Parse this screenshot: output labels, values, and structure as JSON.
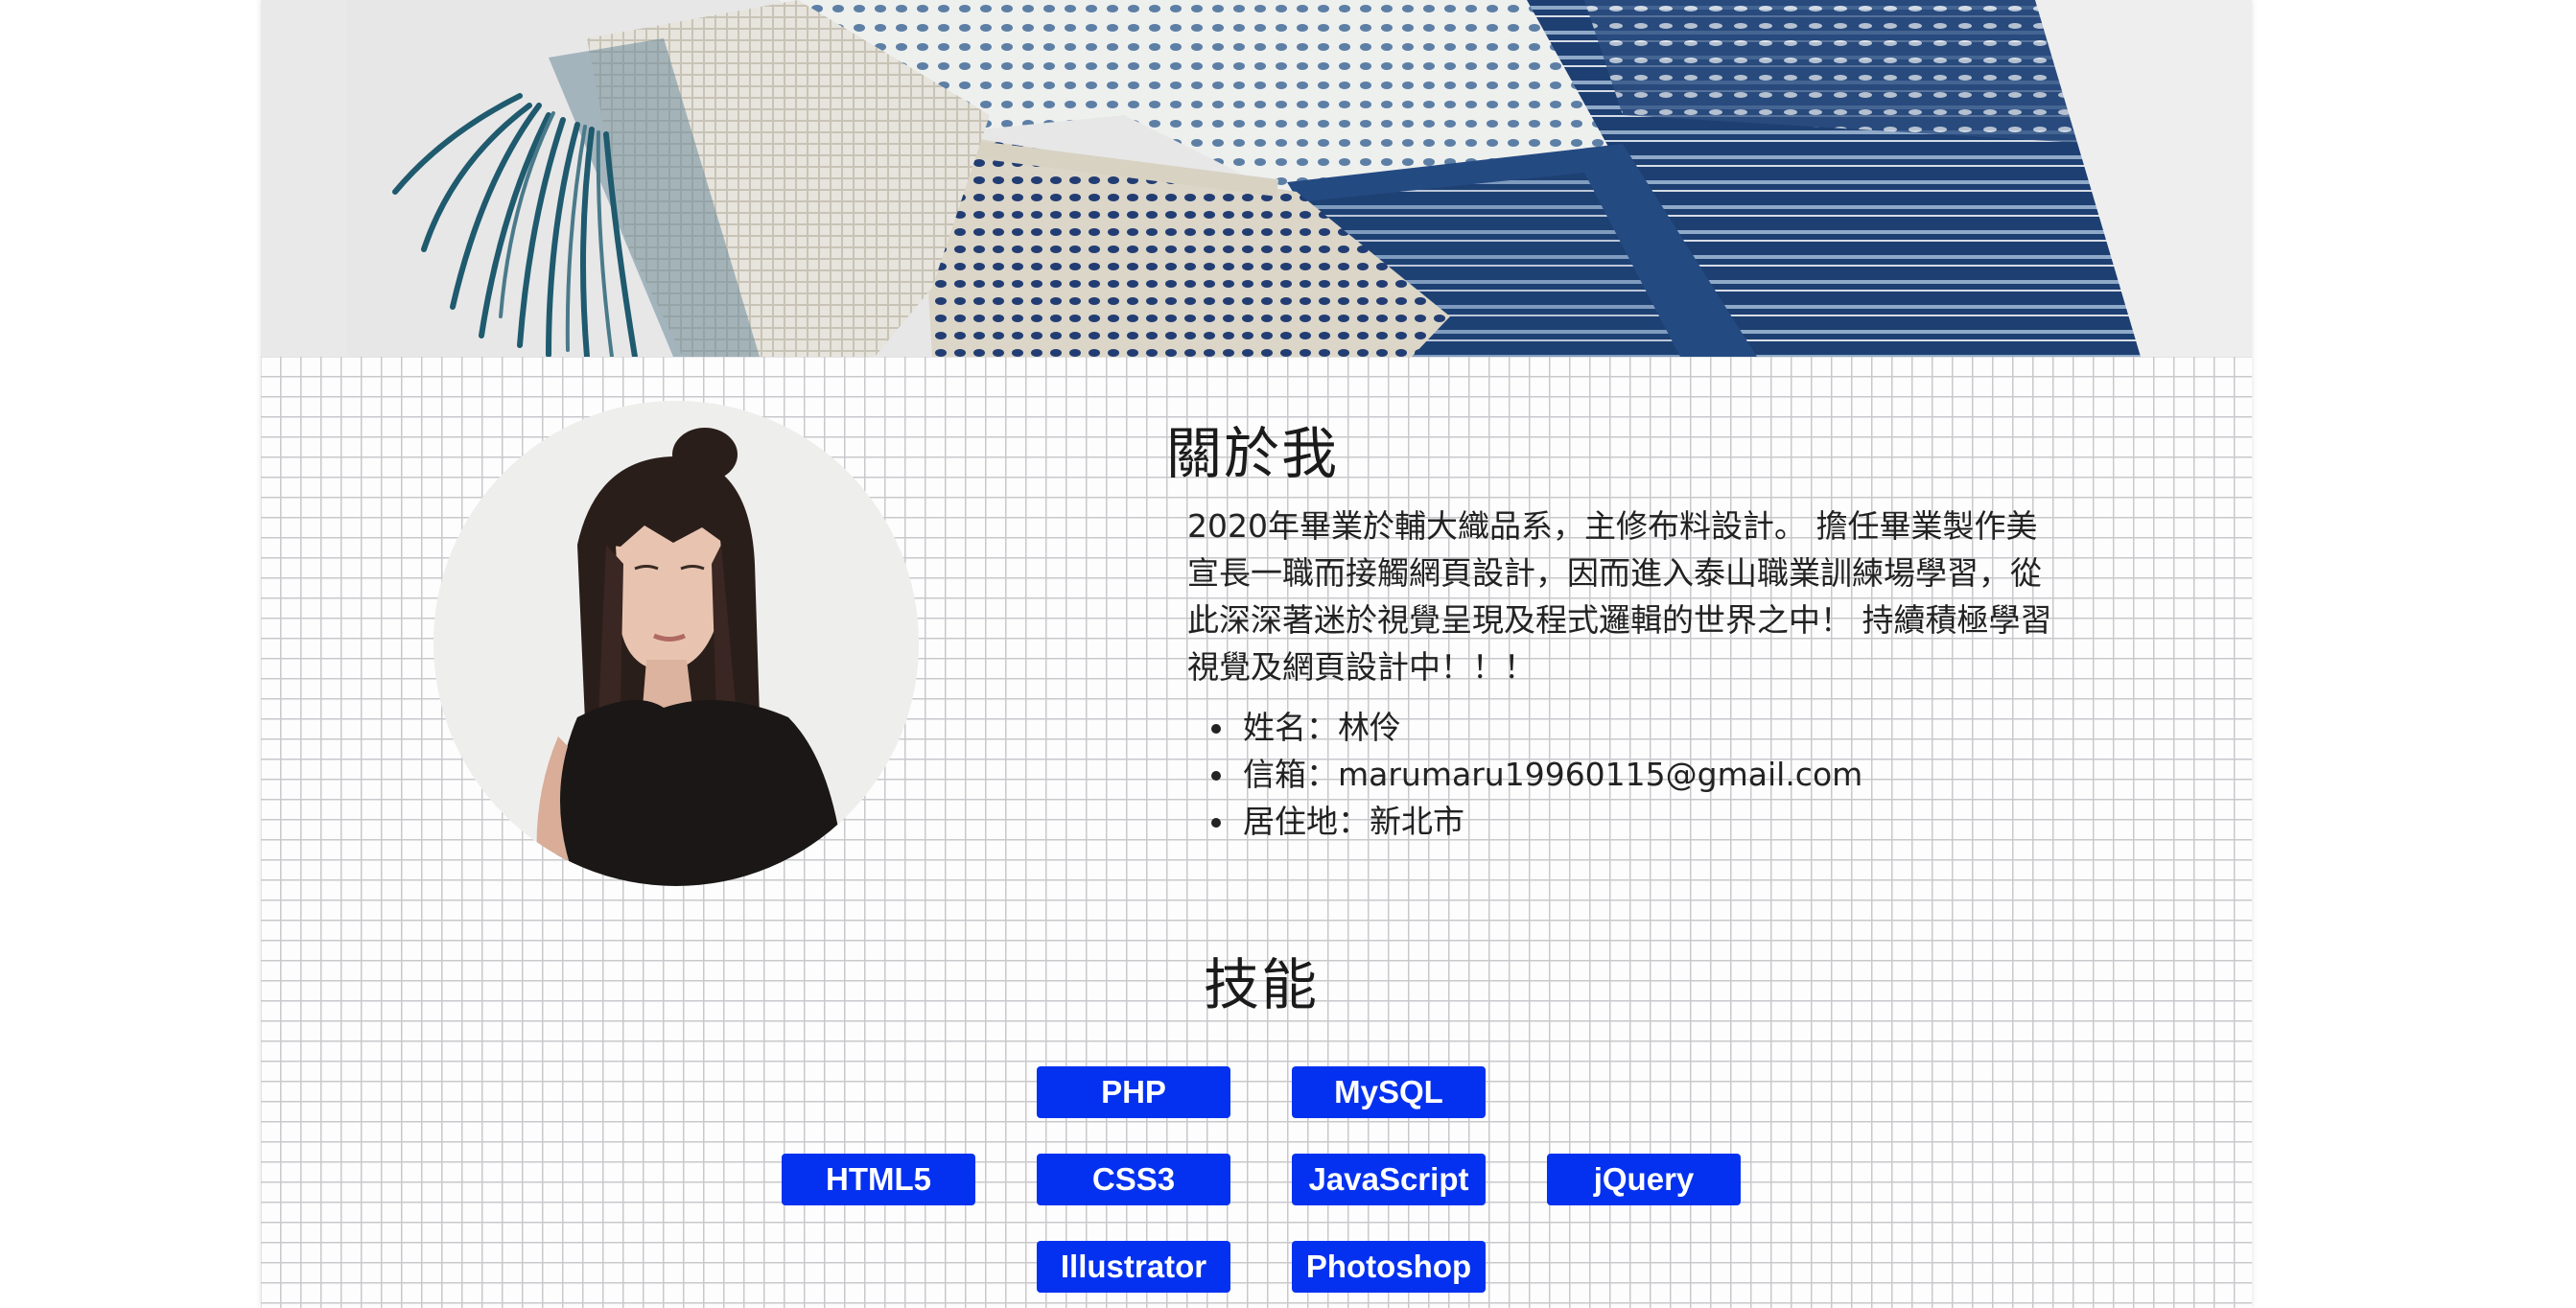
{
  "about": {
    "title": "關於我",
    "description": "2020年畢業於輔大織品系，主修布料設計。 擔任畢業製作美\n宣長一職而接觸網頁設計，因而進入泰山職業訓練場學習，從\n此深深著迷於視覺呈現及程式邏輯的世界之中！ 持續積極學習\n視覺及網頁設計中！！！",
    "info": [
      "姓名：林伶",
      "信箱：marumaru19960115@gmail.com",
      "居住地：新北市"
    ]
  },
  "skills": {
    "title": "技能",
    "rows": [
      [
        "PHP",
        "MySQL"
      ],
      [
        "HTML5",
        "CSS3",
        "JavaScript",
        "jQuery"
      ],
      [
        "Illustrator",
        "Photoshop"
      ]
    ]
  },
  "colors": {
    "skill_button_bg": "#0431f0",
    "skill_button_text": "#ffffff",
    "grid_line": "#c9c9cd"
  }
}
